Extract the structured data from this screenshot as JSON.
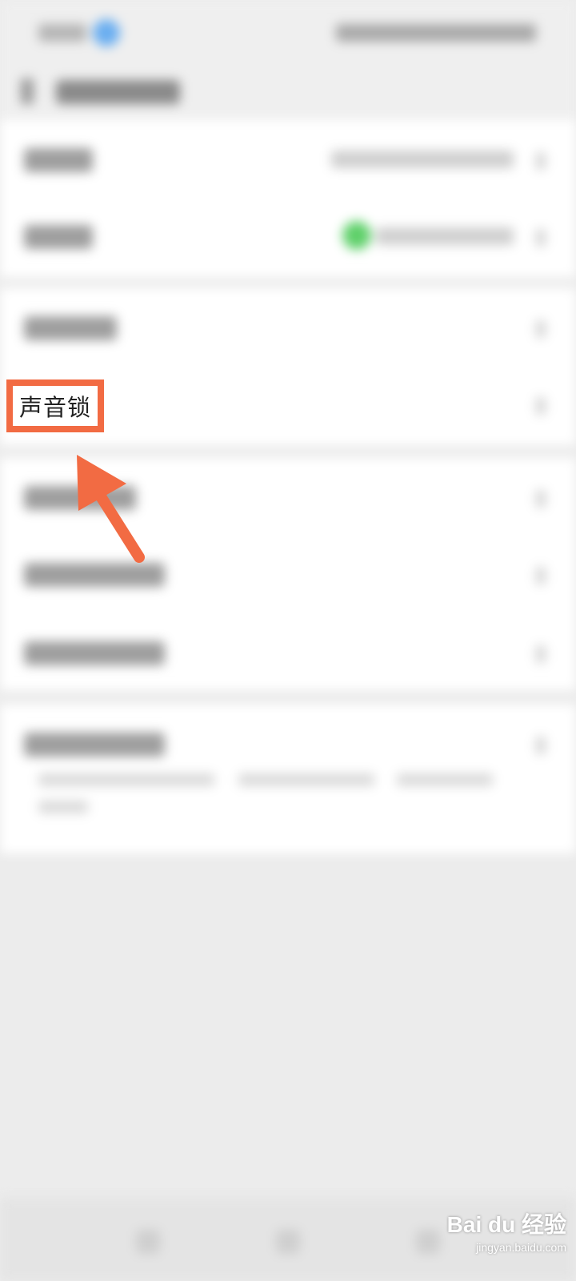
{
  "highlight": {
    "label": "声音锁"
  },
  "watermark": {
    "brand": "Bai du 经验",
    "url": "jingyan.baidu.com"
  },
  "colors": {
    "annotation": "#f26b43",
    "toggle_green": "#5fd06a",
    "status_accent": "#6aaef0"
  },
  "icons": {
    "status": "status-indicator-icon",
    "back": "back-arrow-icon",
    "chevron": "chevron-right-icon",
    "toggle": "toggle-on-icon",
    "annotation_arrow": "pointer-arrow-icon",
    "watermark_logo": "baidu-paw-icon"
  }
}
